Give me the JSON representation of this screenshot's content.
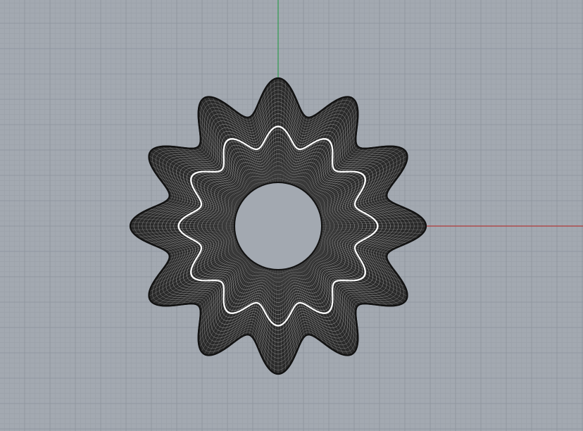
{
  "viewport": {
    "view": "top",
    "background_color": "#a3a9b1",
    "grid": {
      "visible": true,
      "minor_color": "#9aa0a8",
      "major_color": "#8c939c",
      "minor_per_major": 5
    },
    "world_axes": {
      "x_axis_color": "#b03a3a",
      "y_axis_color": "#2f9a4e"
    },
    "object": {
      "shape": "wavy torus mesh (wireframe)",
      "lobe_count": 12,
      "wire_color": "#111111",
      "highlight_curve_color": "#ffffff",
      "hole_color": "#a3a9b1"
    }
  }
}
